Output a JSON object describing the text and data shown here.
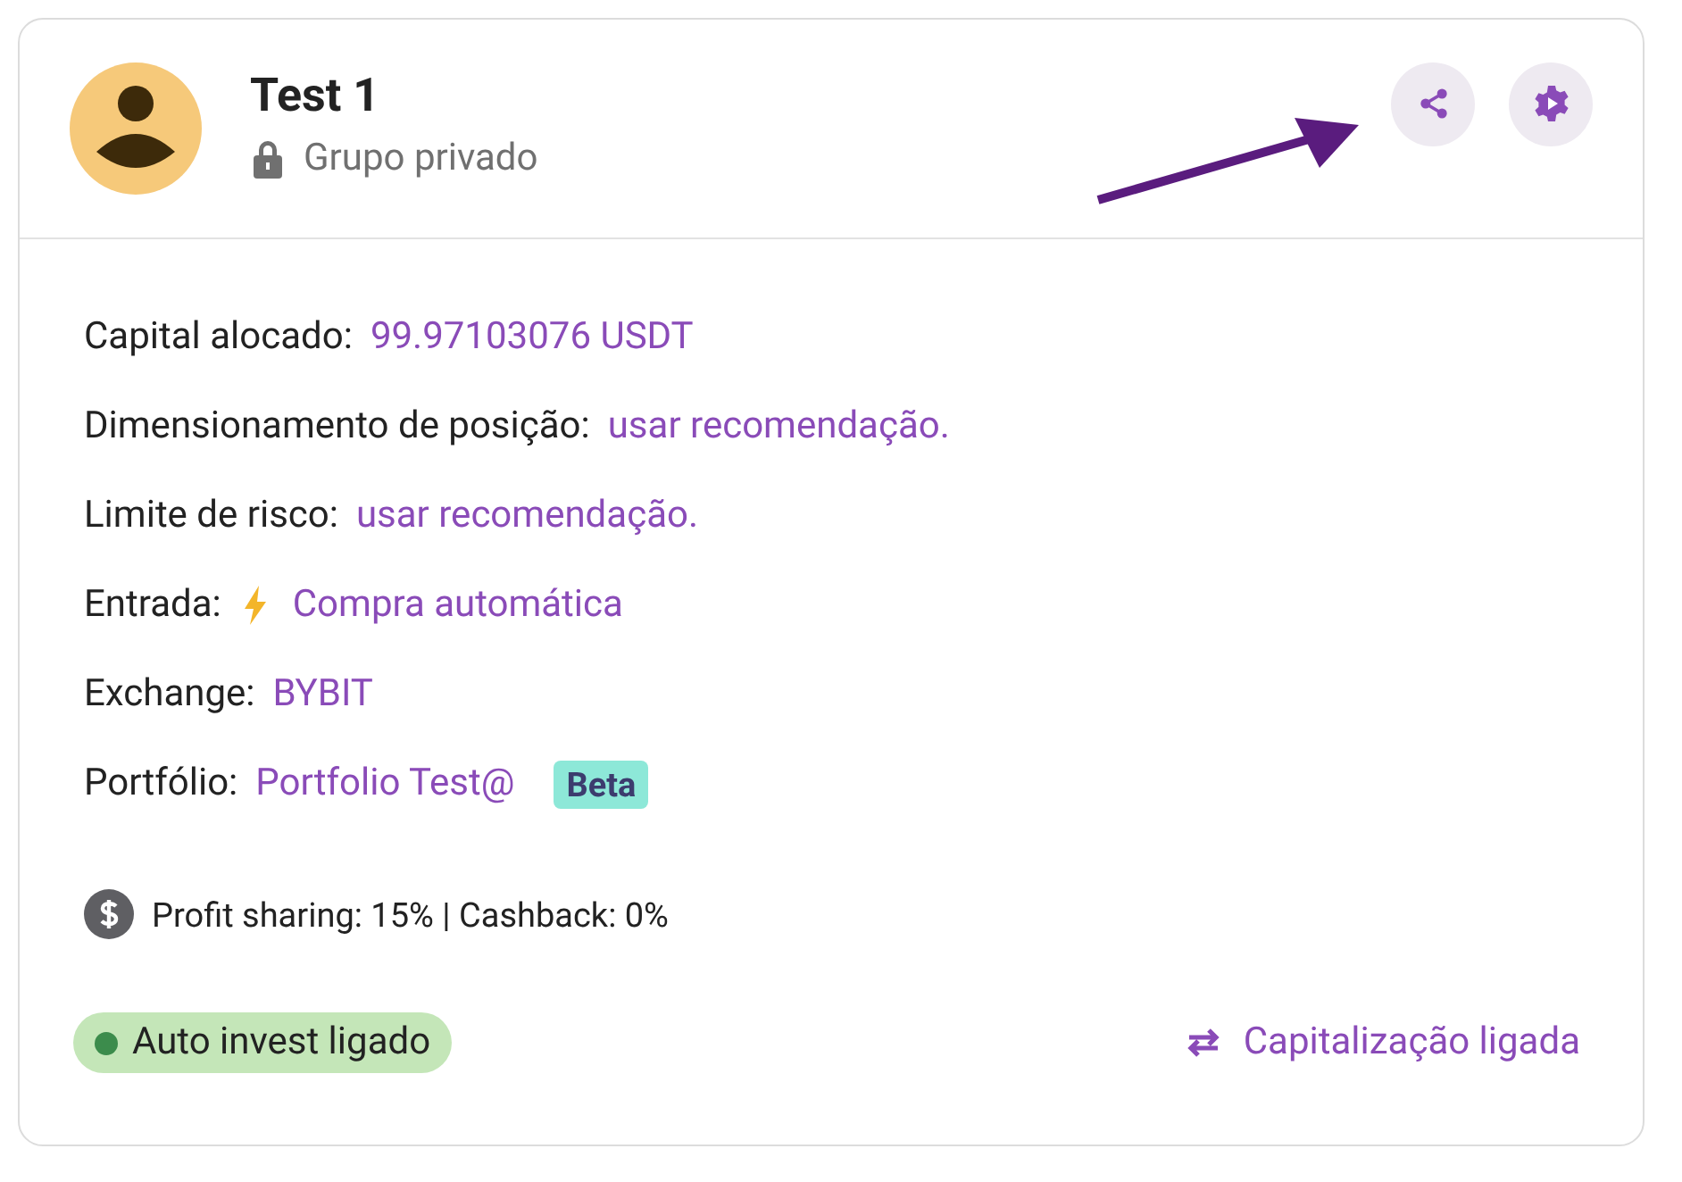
{
  "group": {
    "title": "Test 1",
    "privacy": "Grupo privado"
  },
  "actions": [
    {
      "kind": "share"
    },
    {
      "kind": "settings"
    }
  ],
  "fields": [
    {
      "kind": "plain",
      "label": "Capital alocado:",
      "value": "99.97103076 USDT"
    },
    {
      "kind": "plain",
      "label": "Dimensionamento de posição:",
      "value": "usar recomendação."
    },
    {
      "kind": "plain",
      "label": "Limite de risco:",
      "value": "usar recomendação."
    },
    {
      "kind": "lightning",
      "label": "Entrada:",
      "value": "Compra automática"
    },
    {
      "kind": "plain",
      "label": "Exchange:",
      "value": "BYBIT"
    },
    {
      "kind": "plain",
      "label": "Portfólio:",
      "value": "Portfolio Test@",
      "badge": "Beta"
    }
  ],
  "fees": "Profit sharing: 15% | Cashback: 0%",
  "auto_invest": {
    "label": "Auto invest ligado",
    "on": true
  },
  "capitalization": {
    "label": "Capitalização ligada",
    "on": true
  }
}
